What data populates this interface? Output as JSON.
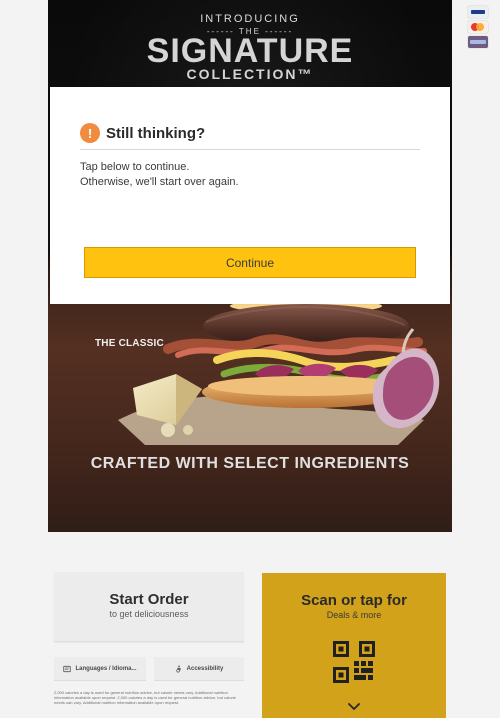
{
  "hero": {
    "intro": "INTRODUCING",
    "the": "------ THE ------",
    "title": "SIGNATURE",
    "subtitle": "COLLECTION™",
    "item_label": "THE CLASSIC",
    "tagline": "CRAFTED WITH SELECT INGREDIENTS"
  },
  "dialog": {
    "title": "Still thinking?",
    "message_line_1": "Tap below to continue.",
    "message_line_2": "Otherwise, we'll start over again.",
    "continue_label": "Continue",
    "icon": "warning-icon"
  },
  "bottom": {
    "start_order_title": "Start Order",
    "start_order_subtitle": "to get deliciousness",
    "languages_label": "Languages / Idioma...",
    "accessibility_label": "Accessibility",
    "legal_text": "2,000 calories a day is used for general nutrition advice, but calorie needs vary. Additional nutrition information available upon request. 2,000 calories a day is used for general nutrition advice, but calorie needs can vary. Additional nutrition information available upon request.",
    "scan_title": "Scan or tap for",
    "scan_subtitle": "Deals & more"
  },
  "icons": {
    "payment": [
      "visa-card-icon",
      "mastercard-card-icon",
      "card-icon"
    ],
    "languages": "globe-icon",
    "accessibility": "accessibility-icon",
    "qr": "qr-code-icon",
    "chevron": "chevron-down-icon"
  },
  "colors": {
    "accent": "#ffc20e",
    "scan_panel": "#d2a21a",
    "warning": "#f18b40",
    "hero_bg": "#111111"
  }
}
